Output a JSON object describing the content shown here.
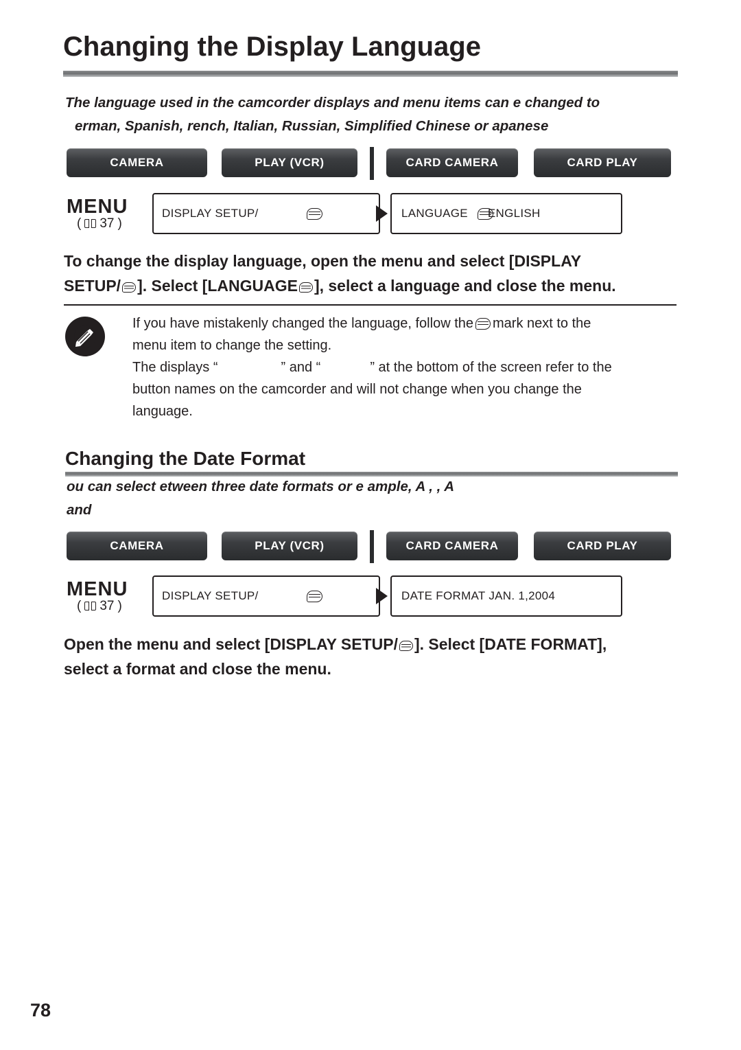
{
  "page": {
    "number": "78",
    "title": "Changing the Display Language"
  },
  "section1": {
    "lead_line1": "The language used in the camcorder displays and menu items can  e changed to",
    "lead_line2": "erman, Spanish,  rench, Italian, Russian, Simplified Chinese or  apanese",
    "modebar": {
      "buttons": [
        {
          "label": "CAMERA"
        },
        {
          "label": "PLAY (VCR)"
        },
        {
          "label": "CARD CAMERA"
        },
        {
          "label": "CARD PLAY"
        }
      ]
    },
    "menu_word": "MENU",
    "page_ref": "37",
    "menu_box_left": "DISPLAY SETUP/",
    "menu_box_right": "LANGUAGE",
    "menu_box_right_value": "ENGLISH",
    "instruction_line1": "To change the display language, open the menu and select [DISPLAY",
    "instruction_line2_a": "SETUP/",
    "instruction_line2_b": "]. Select [LANGUAGE",
    "instruction_line2_c": "], select a language and close the menu.",
    "note_line1_a": "If you have mistakenly changed the language, follow the",
    "note_line1_b": "mark next to the",
    "note_line2": "menu item to change the setting.",
    "note_line3_a": "The displays “",
    "note_line3_b": "” and “",
    "note_line3_c": "” at the bottom of the screen refer to the",
    "note_line4": "button names on the camcorder and will not change when you change the",
    "note_line5": "language."
  },
  "section2": {
    "heading": "Changing the Date Format",
    "lead_line1": "ou can select  etween three date formats   or e ample,   A   ,        ,        A",
    "lead_line2": "and",
    "modebar": {
      "buttons": [
        {
          "label": "CAMERA"
        },
        {
          "label": "PLAY (VCR)"
        },
        {
          "label": "CARD CAMERA"
        },
        {
          "label": "CARD PLAY"
        }
      ]
    },
    "menu_word": "MENU",
    "page_ref": "37",
    "menu_box_left": "DISPLAY SETUP/",
    "menu_box_right": "DATE FORMAT  JAN. 1,2004",
    "instruction_line1_a": "Open the menu and select [DISPLAY SETUP/",
    "instruction_line1_b": "]. Select [DATE FORMAT],",
    "instruction_line2": "select a format and close the menu."
  },
  "icons": {
    "book": "book-icon",
    "display_setup": "display-setup-glyph",
    "note": "pencil-note-icon",
    "arrow": "arrow-right-icon"
  }
}
